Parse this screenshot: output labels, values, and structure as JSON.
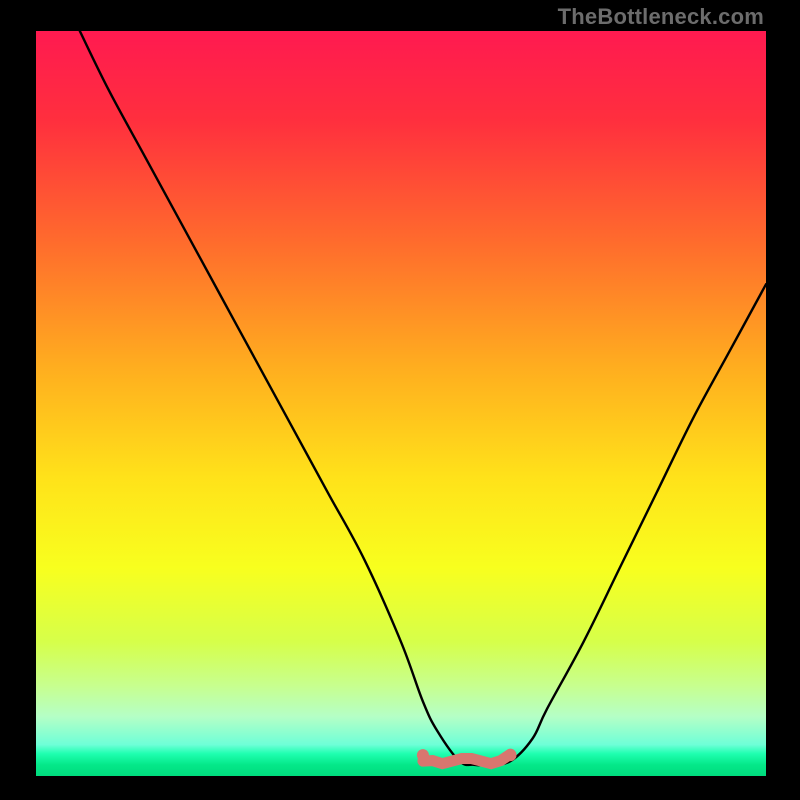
{
  "watermark": "TheBottleneck.com",
  "colors": {
    "black": "#000000",
    "curve": "#000000",
    "marker": "#d8766f",
    "gradient_stops": [
      {
        "offset": 0.0,
        "color": "#ff1a50"
      },
      {
        "offset": 0.12,
        "color": "#ff2f3e"
      },
      {
        "offset": 0.28,
        "color": "#ff6a2d"
      },
      {
        "offset": 0.45,
        "color": "#ffad1f"
      },
      {
        "offset": 0.6,
        "color": "#ffe21a"
      },
      {
        "offset": 0.72,
        "color": "#f8ff1e"
      },
      {
        "offset": 0.82,
        "color": "#d6ff4a"
      },
      {
        "offset": 0.88,
        "color": "#c7ff90"
      },
      {
        "offset": 0.92,
        "color": "#b5ffc6"
      },
      {
        "offset": 0.958,
        "color": "#6effd7"
      },
      {
        "offset": 0.97,
        "color": "#1fffb0"
      },
      {
        "offset": 0.985,
        "color": "#04e889"
      },
      {
        "offset": 1.0,
        "color": "#00db7e"
      }
    ]
  },
  "chart_data": {
    "type": "line",
    "title": "",
    "xlabel": "",
    "ylabel": "",
    "xlim": [
      0,
      100
    ],
    "ylim": [
      0,
      100
    ],
    "series": [
      {
        "name": "curve",
        "x": [
          6,
          10,
          15,
          20,
          25,
          30,
          35,
          40,
          45,
          50,
          53,
          55,
          58,
          60,
          62,
          65,
          68,
          70,
          75,
          80,
          85,
          90,
          95,
          100
        ],
        "y": [
          100,
          92,
          83,
          74,
          65,
          56,
          47,
          38,
          29,
          18,
          10,
          6,
          2,
          1.5,
          1.5,
          2,
          5,
          9,
          18,
          28,
          38,
          48,
          57,
          66
        ]
      }
    ],
    "floor_marker": {
      "x_range": [
        53,
        65
      ],
      "y": 2.0
    }
  }
}
